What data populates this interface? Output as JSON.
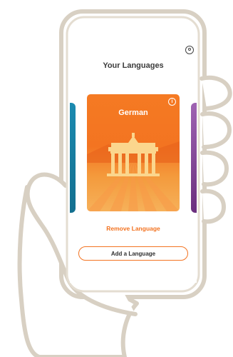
{
  "screen": {
    "title": "Your Languages",
    "remove_label": "Remove Language",
    "add_label": "Add a Language",
    "info_glyph": "i",
    "profile_icon": "profile-icon"
  },
  "cards": [
    {
      "name": "German",
      "color": "#f37321"
    }
  ],
  "colors": {
    "accent": "#f37321",
    "left_card": "#1b8ab0",
    "right_card": "#8a4aa0",
    "sketch": "#d9d1c4"
  }
}
